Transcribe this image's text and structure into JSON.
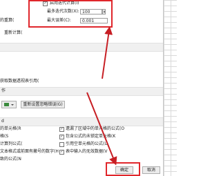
{
  "colors": {
    "highlight": "#e0262b",
    "arrow": "#c71f24"
  },
  "iteration": {
    "enable_label": "启用迭代计算(I)",
    "enable_checked": true,
    "max_iterations_label": "最多迭代次数(X):",
    "max_iterations_value": "100",
    "max_change_label": "最大误差(C):",
    "max_change_value": "0.001"
  },
  "partial_labels": {
    "recalc": "的重算(",
    "data_table": "重新计算(",
    "functions": "获取数据透视表引用(",
    "section3": "作",
    "section4": "d"
  },
  "color_button_icon": "color-swatch-icon",
  "reset_button_label": "重新设置忽略错误(G)",
  "error_rules": {
    "left": [
      "的单元格(R",
      "格(S",
      "计算列公式(",
      "文本格式或前面有撇号的数字(H",
      "致的公式(N"
    ],
    "right": [
      "遗漏了区域中的单元格的公式(O",
      "包含公式的未锁定单元格(K",
      "引用空单元格的公式(U",
      "表中输入的无效数据(V"
    ]
  },
  "buttons": {
    "ok": "确定",
    "cancel": "取消"
  }
}
